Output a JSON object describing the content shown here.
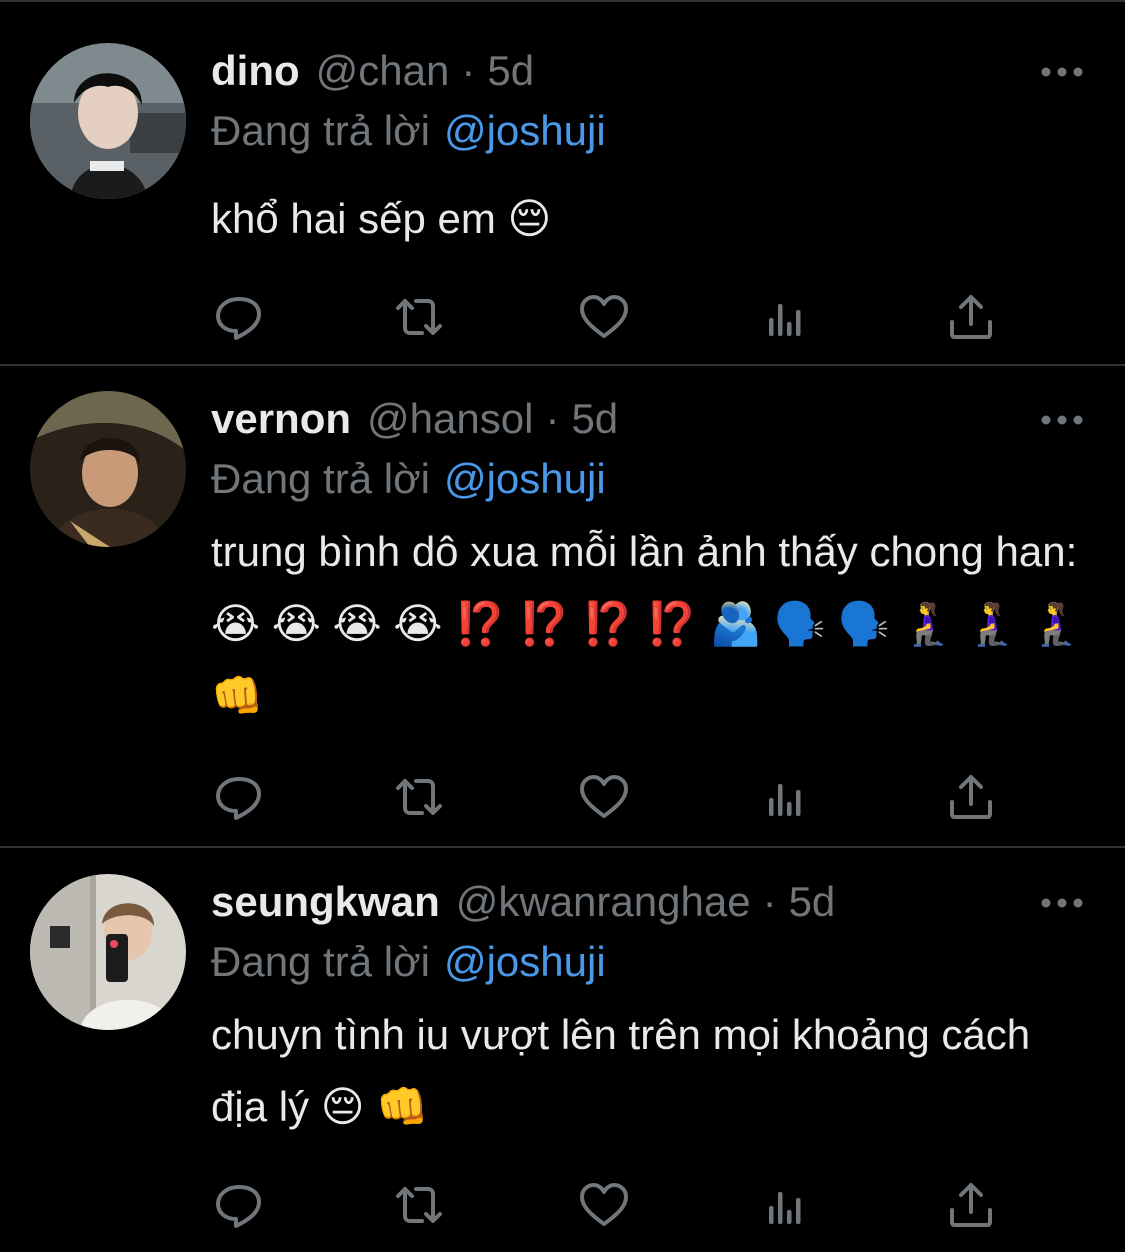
{
  "tweets": [
    {
      "name": "dino",
      "handle": "@chan",
      "dot": "·",
      "time": "5d",
      "reply_prefix": "Đang trả lời",
      "reply_to": "@joshuji",
      "text": "khổ hai sếp em 😔"
    },
    {
      "name": "vernon",
      "handle": "@hansol",
      "dot": "·",
      "time": "5d",
      "reply_prefix": "Đang trả lời",
      "reply_to": "@joshuji",
      "text": "trung bình dô xua mỗi lần ảnh thấy chong han: 😭 😭 😭 😭 ⁉️ ⁉️ ⁉️ ⁉️ 🫂 🗣️ 🗣️ 🧎‍♀️ 🧎‍♀️ 🧎‍♀️ 👊"
    },
    {
      "name": "seungkwan",
      "handle": "@kwanranghae",
      "dot": "·",
      "time": "5d",
      "reply_prefix": "Đang trả lời",
      "reply_to": "@joshuji",
      "text": "chuyn tình iu vượt lên trên mọi khoảng cách địa lý 😔 👊"
    }
  ],
  "actions": [
    "reply-icon",
    "retweet-icon",
    "like-icon",
    "analytics-icon",
    "share-icon"
  ],
  "colors": {
    "background": "#000000",
    "text": "#e7e9ea",
    "muted": "#71767b",
    "link": "#4a99e9",
    "divider": "#2f3336"
  }
}
